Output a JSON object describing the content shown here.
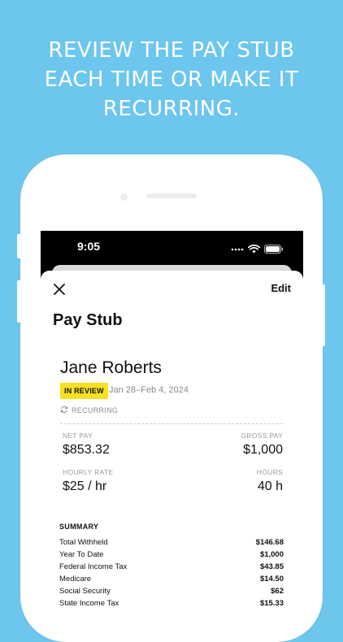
{
  "headline": {
    "line1": "REVIEW THE PAY STUB",
    "line2": "EACH TIME OR MAKE IT",
    "line3": "RECURRING."
  },
  "status_bar": {
    "time": "9:05"
  },
  "header": {
    "edit_label": "Edit",
    "title": "Pay Stub"
  },
  "employee": {
    "name": "Jane Roberts",
    "status_badge": "IN REVIEW",
    "period": "Jan 28–Feb 4, 2024",
    "recurring_label": "RECURRING"
  },
  "pay": {
    "net_pay_label": "NET PAY",
    "net_pay": "$853.32",
    "gross_pay_label": "GROSS PAY",
    "gross_pay": "$1,000",
    "hourly_rate_label": "HOURLY RATE",
    "hourly_rate": "$25 / hr",
    "hours_label": "HOURS",
    "hours": "40 h"
  },
  "summary": {
    "title": "SUMMARY",
    "rows": [
      {
        "label": "Total Withheld",
        "amount": "$146.68"
      },
      {
        "label": "Year To Date",
        "amount": "$1,000"
      },
      {
        "label": "Federal Income Tax",
        "amount": "$43.85"
      },
      {
        "label": "Medicare",
        "amount": "$14.50"
      },
      {
        "label": "Social Security",
        "amount": "$62"
      },
      {
        "label": "State Income Tax",
        "amount": "$15.33"
      }
    ]
  },
  "colors": {
    "background": "#6cc6ee",
    "badge": "#f7e01f"
  },
  "icons": {
    "close": "close-icon",
    "recurring": "refresh-icon",
    "signal": "signal-icon",
    "wifi": "wifi-icon",
    "battery": "battery-icon"
  }
}
